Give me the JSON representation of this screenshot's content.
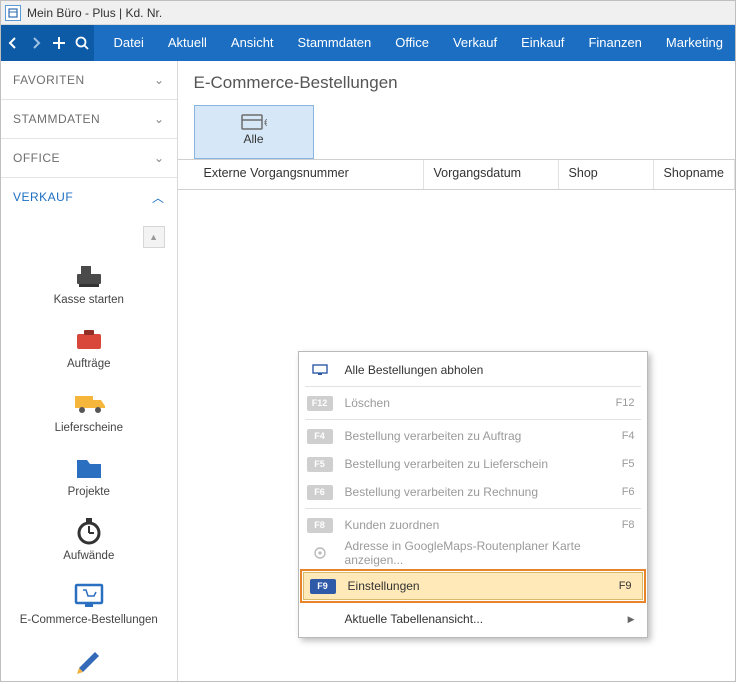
{
  "title": "Mein Büro - Plus | Kd. Nr.",
  "topbar": {
    "menu": [
      "Datei",
      "Aktuell",
      "Ansicht",
      "Stammdaten",
      "Office",
      "Verkauf",
      "Einkauf",
      "Finanzen",
      "Marketing"
    ]
  },
  "sidebar": {
    "groups": [
      {
        "label": "FAVORITEN",
        "open": false
      },
      {
        "label": "STAMMDATEN",
        "open": false
      },
      {
        "label": "OFFICE",
        "open": false
      },
      {
        "label": "VERKAUF",
        "open": true
      }
    ],
    "verkauf_items": [
      {
        "id": "kasse",
        "label": "Kasse starten"
      },
      {
        "id": "auftraege",
        "label": "Aufträge"
      },
      {
        "id": "lieferscheine",
        "label": "Lieferscheine"
      },
      {
        "id": "projekte",
        "label": "Projekte"
      },
      {
        "id": "aufwaende",
        "label": "Aufwände"
      },
      {
        "id": "ecommerce",
        "label": "E-Commerce-Bestellungen"
      }
    ]
  },
  "content": {
    "heading": "E-Commerce-Bestellungen",
    "filter_alle": "Alle",
    "columns": [
      "Externe Vorgangsnummer",
      "Vorgangsdatum",
      "Shop",
      "Shopname"
    ]
  },
  "context_menu": [
    {
      "icon": "monitor",
      "label": "Alle Bestellungen abholen",
      "shortcut": "",
      "enabled": true,
      "type": "item"
    },
    {
      "type": "sep"
    },
    {
      "badge": "F12",
      "label": "Löschen",
      "shortcut": "F12",
      "enabled": false,
      "type": "item"
    },
    {
      "type": "sep"
    },
    {
      "badge": "F4",
      "label": "Bestellung verarbeiten zu Auftrag",
      "shortcut": "F4",
      "enabled": false,
      "type": "item"
    },
    {
      "badge": "F5",
      "label": "Bestellung verarbeiten zu Lieferschein",
      "shortcut": "F5",
      "enabled": false,
      "type": "item"
    },
    {
      "badge": "F6",
      "label": "Bestellung verarbeiten zu Rechnung",
      "shortcut": "F6",
      "enabled": false,
      "type": "item"
    },
    {
      "type": "sep"
    },
    {
      "badge": "F8",
      "label": "Kunden zuordnen",
      "shortcut": "F8",
      "enabled": false,
      "type": "item"
    },
    {
      "icon": "target",
      "label": "Adresse in GoogleMaps-Routenplaner Karte anzeigen...",
      "shortcut": "",
      "enabled": false,
      "type": "item"
    },
    {
      "type": "sep"
    },
    {
      "badge": "F9",
      "label": "Einstellungen",
      "shortcut": "F9",
      "enabled": true,
      "type": "highlight"
    },
    {
      "type": "sep"
    },
    {
      "label": "Aktuelle Tabellenansicht...",
      "shortcut": "",
      "enabled": true,
      "type": "submenu"
    }
  ]
}
